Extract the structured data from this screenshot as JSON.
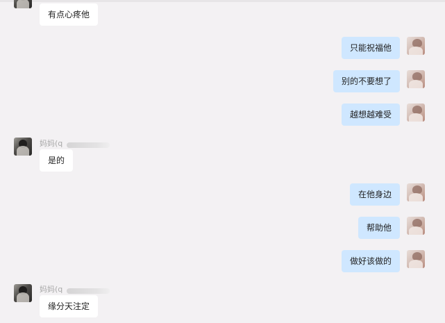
{
  "messages": [
    {
      "sender": "other",
      "text": "有点心疼他"
    },
    {
      "sender": "self",
      "text": "只能祝福他"
    },
    {
      "sender": "self",
      "text": "别的不要想了"
    },
    {
      "sender": "self",
      "text": "越想越难受"
    },
    {
      "sender": "other",
      "name": "妈妈(q",
      "text": "是的"
    },
    {
      "sender": "self",
      "text": "在他身边"
    },
    {
      "sender": "self",
      "text": "帮助他"
    },
    {
      "sender": "self",
      "text": "做好该做的"
    },
    {
      "sender": "other",
      "name": "妈妈(q",
      "text": "缘分天注定"
    }
  ],
  "colors": {
    "background": "#f3f1f3",
    "self_bubble": "#cfe7ff",
    "other_bubble": "#ffffff",
    "sender_name": "#a9a9a9"
  }
}
